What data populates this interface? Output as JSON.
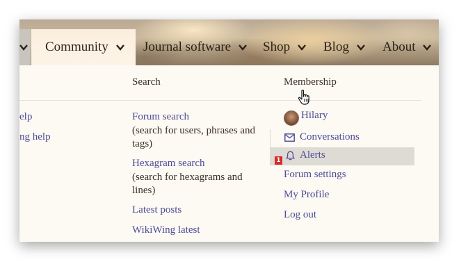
{
  "nav": {
    "items": [
      {
        "label": "Community"
      },
      {
        "label": "Journal software"
      },
      {
        "label": "Shop"
      },
      {
        "label": "Blog"
      },
      {
        "label": "About"
      }
    ]
  },
  "menu": {
    "left_col": {
      "links": [
        "elp",
        "ng help"
      ]
    },
    "search_col": {
      "heading": "Search",
      "forum_search": "Forum search",
      "forum_search_note": "(search for users, phrases and tags)",
      "hexagram_search": "Hexagram search",
      "hexagram_search_note": "(search for hexagrams and lines)",
      "latest_posts": "Latest posts",
      "wikiwing_latest": "WikiWing latest"
    },
    "membership_col": {
      "heading": "Membership",
      "username": "Hilary",
      "conversations": "Conversations",
      "alerts": "Alerts",
      "alerts_badge": "1",
      "forum_settings": "Forum settings",
      "my_profile": "My Profile",
      "log_out": "Log out"
    }
  },
  "icons": {
    "chevron": "chevron-down-icon",
    "envelope": "envelope-icon",
    "bell": "bell-icon",
    "cursor": "hand-pointer-cursor-icon"
  },
  "colors": {
    "link": "#4a4c96",
    "badge": "#d62b2b",
    "highlight": "#dedad4"
  }
}
